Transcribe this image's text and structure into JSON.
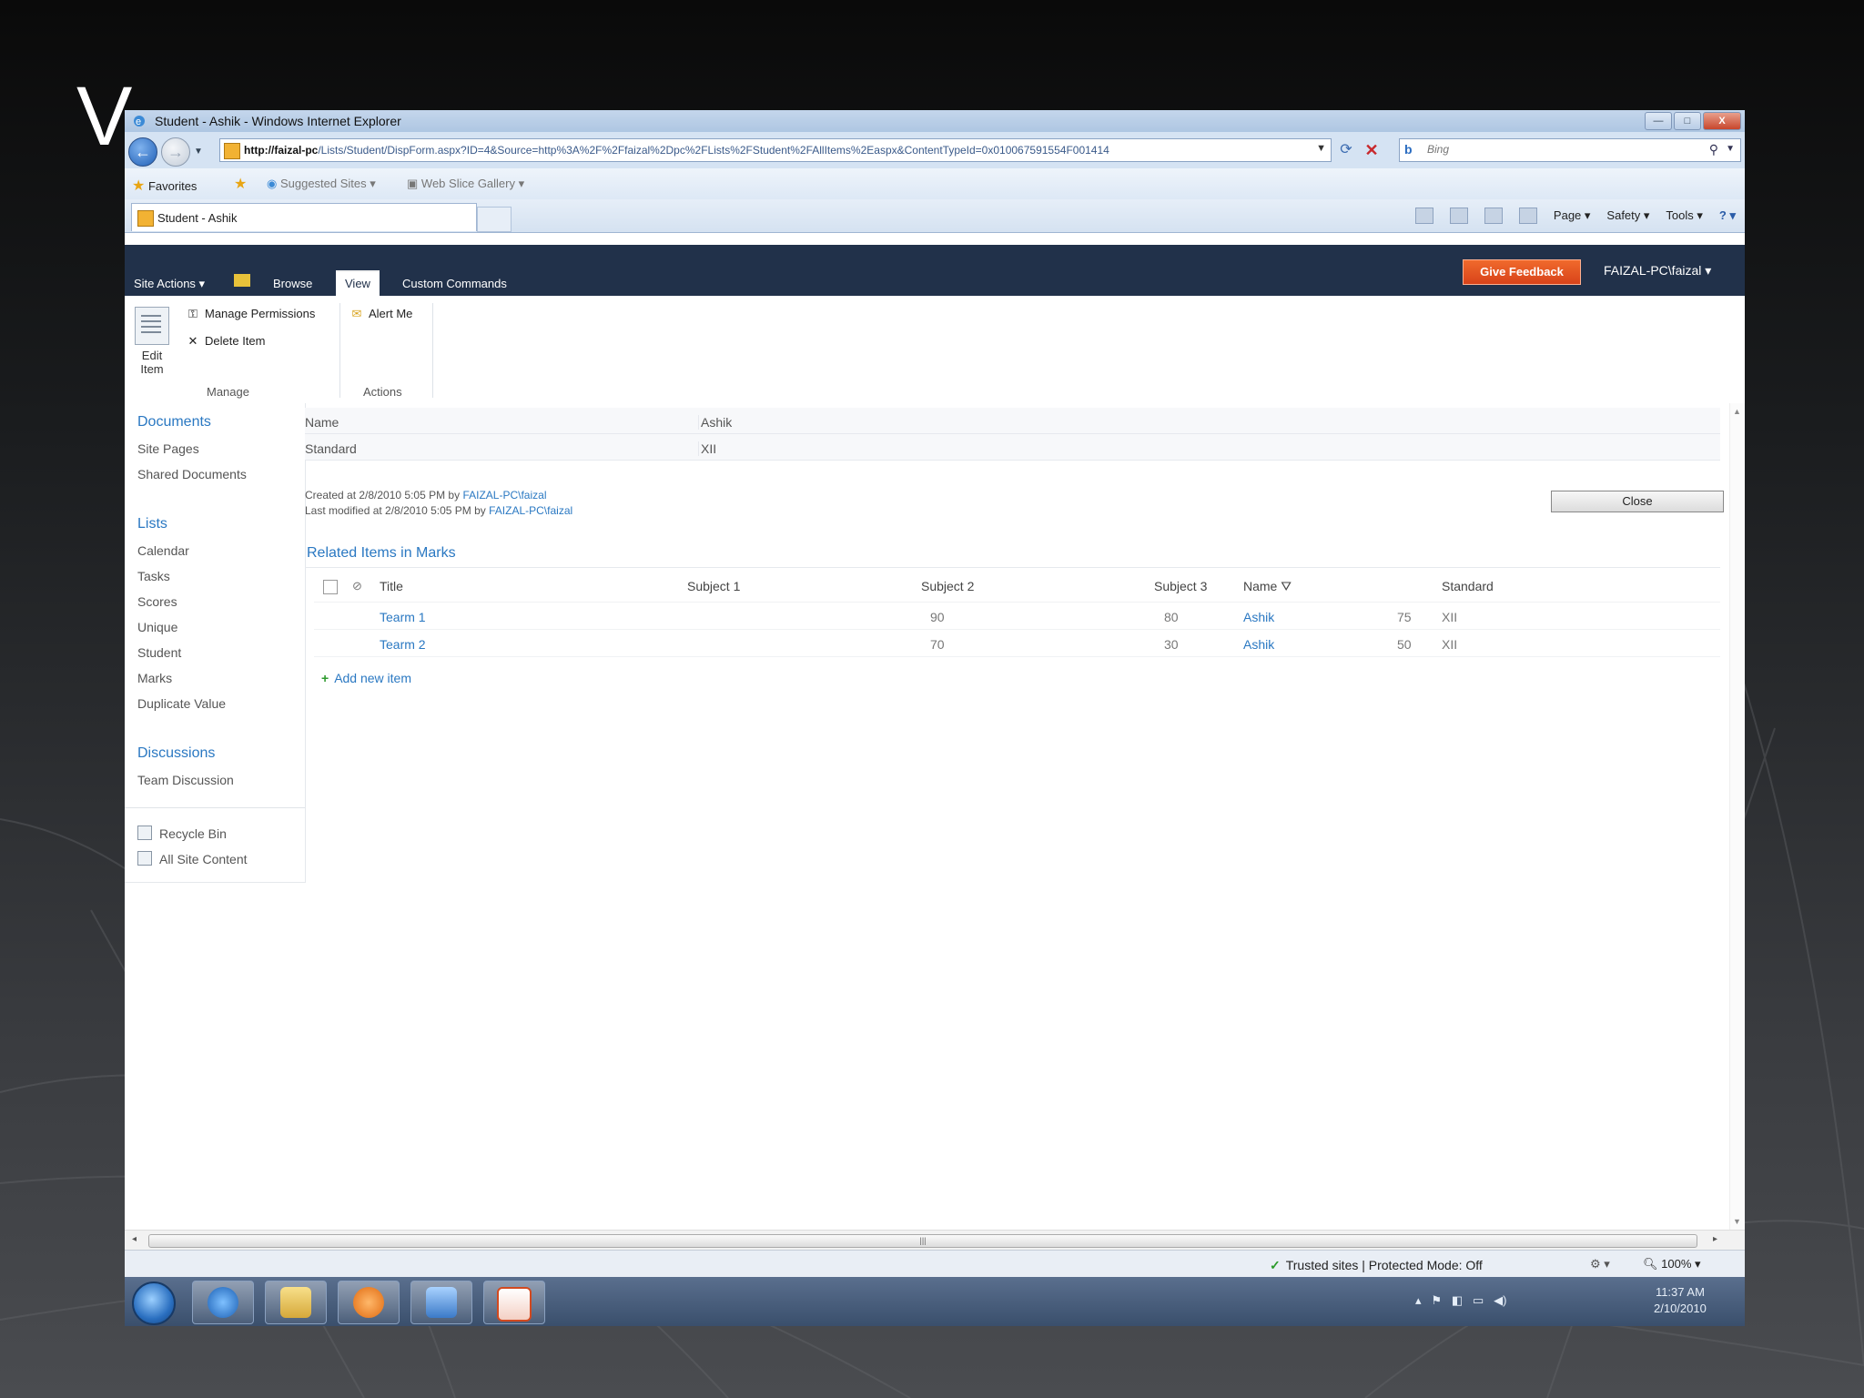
{
  "slide": {
    "title_fragment": "V"
  },
  "window": {
    "title": "Student - Ashik - Windows Internet Explorer",
    "buttons": {
      "minimize": "—",
      "maximize": "□",
      "close": "X"
    }
  },
  "address": {
    "url_host": "http://faizal-pc",
    "url_path": "/Lists/Student/DispForm.aspx?ID=4&Source=http%3A%2F%2Ffaizal%2Dpc%2FLists%2FStudent%2FAllItems%2Easpx&ContentTypeId=0x010067591554F001414",
    "search_placeholder": "Bing"
  },
  "favorites": {
    "favorites_label": "Favorites",
    "suggested_sites": "Suggested Sites ▾",
    "web_slice_gallery": "Web Slice Gallery ▾"
  },
  "tab": {
    "label": "Student - Ashik"
  },
  "commandbar": {
    "page": "Page ▾",
    "safety": "Safety ▾",
    "tools": "Tools ▾",
    "help": "? ▾"
  },
  "ribbon": {
    "site_actions": "Site Actions ▾",
    "tabs": [
      "Browse",
      "View",
      "Custom Commands"
    ],
    "give_feedback": "Give Feedback",
    "user": "FAIZAL-PC\\faizal ▾",
    "edit_item": "Edit Item",
    "manage_permissions": "Manage Permissions",
    "delete_item": "Delete Item",
    "alert_me": "Alert Me",
    "group_manage": "Manage",
    "group_actions": "Actions"
  },
  "leftnav": {
    "documents": "Documents",
    "site_pages": "Site Pages",
    "shared_documents": "Shared Documents",
    "lists": "Lists",
    "list_items": [
      "Calendar",
      "Tasks",
      "Scores",
      "Unique",
      "Student",
      "Marks",
      "Duplicate Value"
    ],
    "discussions": "Discussions",
    "team_discussion": "Team Discussion",
    "recycle_bin": "Recycle Bin",
    "all_site_content": "All Site Content"
  },
  "form": {
    "fields": [
      {
        "label": "Name",
        "value": "Ashik"
      },
      {
        "label": "Standard",
        "value": "XII"
      }
    ],
    "created_prefix": "Created at 2/8/2010 5:05 PM by ",
    "created_by": "FAIZAL-PC\\faizal",
    "modified_prefix": "Last modified at 2/8/2010 5:05 PM by ",
    "modified_by": "FAIZAL-PC\\faizal",
    "close_label": "Close"
  },
  "related": {
    "title": "Related Items in Marks",
    "columns": [
      "Title",
      "Subject 1",
      "Subject 2",
      "Subject 3",
      "Name",
      "Standard"
    ],
    "rows": [
      {
        "title": "Tearm 1",
        "s1": "90",
        "s2": "80",
        "s3": "75",
        "name": "Ashik",
        "standard": "XII"
      },
      {
        "title": "Tearm 2",
        "s1": "70",
        "s2": "30",
        "s3": "50",
        "name": "Ashik",
        "standard": "XII"
      }
    ],
    "add_new_item": "Add new item"
  },
  "statusbar": {
    "trusted": "Trusted sites | Protected Mode: Off",
    "zoom": "100%"
  },
  "taskbar": {
    "time": "11:37 AM",
    "date": "2/10/2010"
  }
}
